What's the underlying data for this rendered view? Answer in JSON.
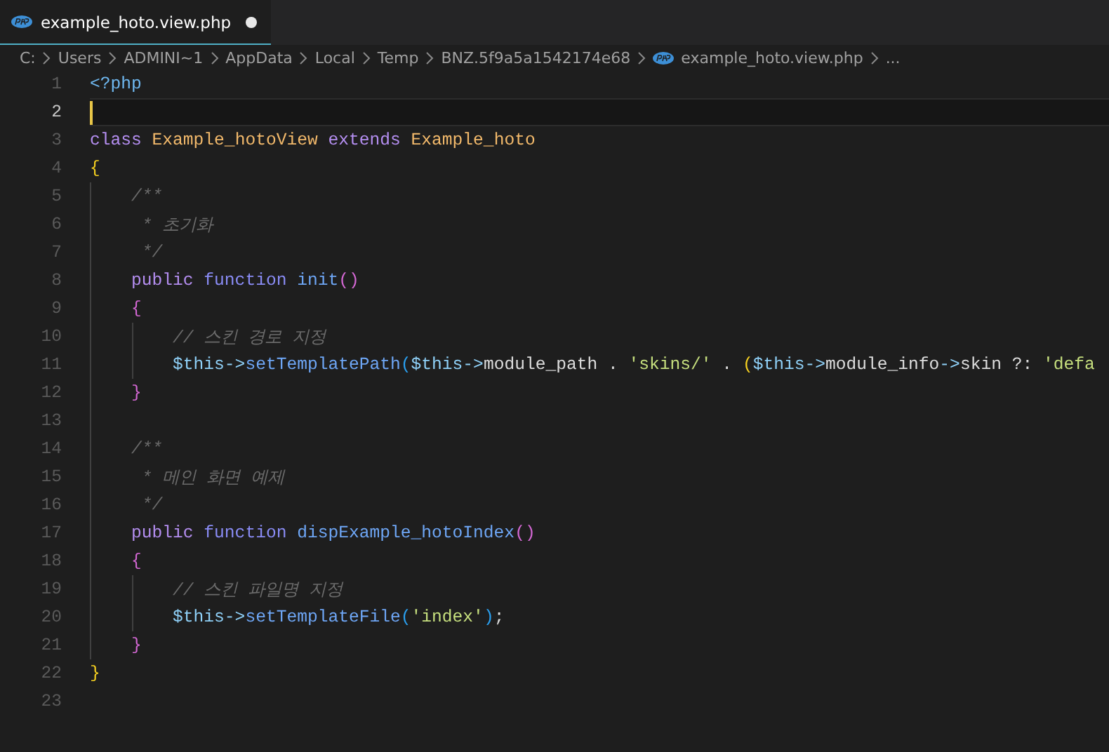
{
  "tabs": [
    {
      "label": "example_hoto.view.php",
      "selected": true,
      "modified": true
    }
  ],
  "breadcrumbs": [
    {
      "label": "C:",
      "kind": "text"
    },
    {
      "label": "Users",
      "kind": "text"
    },
    {
      "label": "ADMINI~1",
      "kind": "text"
    },
    {
      "label": "AppData",
      "kind": "text"
    },
    {
      "label": "Local",
      "kind": "text"
    },
    {
      "label": "Temp",
      "kind": "text"
    },
    {
      "label": "BNZ.5f9a5a1542174e68",
      "kind": "text"
    },
    {
      "label": "example_hoto.view.php",
      "kind": "file"
    },
    {
      "label": "...",
      "kind": "text"
    }
  ],
  "lines": [
    {
      "number": "1",
      "current": false,
      "tokens": [
        {
          "kind": "tag",
          "text": "<?php"
        }
      ]
    },
    {
      "number": "2",
      "current": true
    },
    {
      "number": "3",
      "current": false,
      "tokens": [
        {
          "kind": "keyword",
          "text": "class "
        },
        {
          "kind": "classname",
          "text": "Example_hotoView "
        },
        {
          "kind": "keyword",
          "text": "extends "
        },
        {
          "kind": "classname",
          "text": "Example_hoto"
        }
      ]
    },
    {
      "number": "4",
      "current": false,
      "tokens": [
        {
          "kind": "bracket1",
          "text": "{"
        }
      ]
    },
    {
      "number": "5",
      "current": false,
      "tokens": [
        {
          "kind": "comment",
          "text": "    /**"
        }
      ]
    },
    {
      "number": "6",
      "current": false,
      "tokens": [
        {
          "kind": "comment",
          "text": "     * 초기화"
        }
      ]
    },
    {
      "number": "7",
      "current": false,
      "tokens": [
        {
          "kind": "comment",
          "text": "     */"
        }
      ]
    },
    {
      "number": "8",
      "current": false,
      "tokens": [
        {
          "kind": "keyword",
          "text": "    public "
        },
        {
          "kind": "storage",
          "text": "function "
        },
        {
          "kind": "function",
          "text": "init"
        },
        {
          "kind": "bracket2",
          "text": "()"
        }
      ]
    },
    {
      "number": "9",
      "current": false,
      "tokens": [
        {
          "kind": "bracket2",
          "text": "    {"
        }
      ]
    },
    {
      "number": "10",
      "current": false,
      "tokens": [
        {
          "kind": "comment",
          "text": "        // 스킨 경로 지정"
        }
      ]
    },
    {
      "number": "11",
      "current": false,
      "tokens": [
        {
          "kind": "variable",
          "text": "        $this->"
        },
        {
          "kind": "function",
          "text": "setTemplatePath"
        },
        {
          "kind": "bracket3",
          "text": "("
        },
        {
          "kind": "variable",
          "text": "$this->"
        },
        {
          "kind": "plain",
          "text": "module_path . "
        },
        {
          "kind": "string",
          "text": "'skins/'"
        },
        {
          "kind": "plain",
          "text": " . "
        },
        {
          "kind": "bracket1",
          "text": "("
        },
        {
          "kind": "variable",
          "text": "$this->"
        },
        {
          "kind": "plain",
          "text": "module_info"
        },
        {
          "kind": "variable",
          "text": "->"
        },
        {
          "kind": "plain",
          "text": "skin ?: "
        },
        {
          "kind": "string",
          "text": "'defa"
        }
      ]
    },
    {
      "number": "12",
      "current": false,
      "tokens": [
        {
          "kind": "bracket2",
          "text": "    }"
        }
      ]
    },
    {
      "number": "13",
      "current": false
    },
    {
      "number": "14",
      "current": false,
      "tokens": [
        {
          "kind": "comment",
          "text": "    /**"
        }
      ]
    },
    {
      "number": "15",
      "current": false,
      "tokens": [
        {
          "kind": "comment",
          "text": "     * 메인 화면 예제"
        }
      ]
    },
    {
      "number": "16",
      "current": false,
      "tokens": [
        {
          "kind": "comment",
          "text": "     */"
        }
      ]
    },
    {
      "number": "17",
      "current": false,
      "tokens": [
        {
          "kind": "keyword",
          "text": "    public "
        },
        {
          "kind": "storage",
          "text": "function "
        },
        {
          "kind": "function",
          "text": "dispExample_hotoIndex"
        },
        {
          "kind": "bracket2",
          "text": "()"
        }
      ]
    },
    {
      "number": "18",
      "current": false,
      "tokens": [
        {
          "kind": "bracket2",
          "text": "    {"
        }
      ]
    },
    {
      "number": "19",
      "current": false,
      "tokens": [
        {
          "kind": "comment",
          "text": "        // 스킨 파일명 지정"
        }
      ]
    },
    {
      "number": "20",
      "current": false,
      "tokens": [
        {
          "kind": "variable",
          "text": "        $this->"
        },
        {
          "kind": "function",
          "text": "setTemplateFile"
        },
        {
          "kind": "bracket3",
          "text": "("
        },
        {
          "kind": "string",
          "text": "'index'"
        },
        {
          "kind": "bracket3",
          "text": ")"
        },
        {
          "kind": "plain",
          "text": ";"
        }
      ]
    },
    {
      "number": "21",
      "current": false,
      "tokens": [
        {
          "kind": "bracket2",
          "text": "    }"
        }
      ]
    },
    {
      "number": "22",
      "current": false,
      "tokens": [
        {
          "kind": "bracket1",
          "text": "}"
        }
      ]
    },
    {
      "number": "23",
      "current": false
    }
  ]
}
